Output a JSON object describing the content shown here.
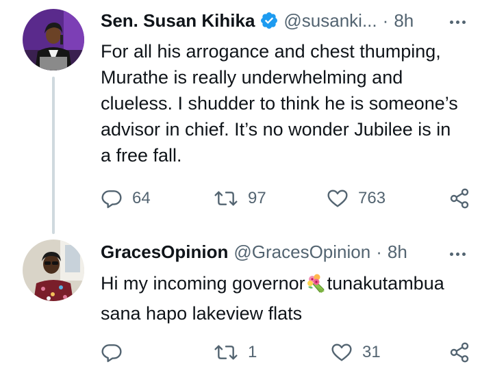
{
  "tweets": [
    {
      "name": "Sen. Susan Kihika",
      "verified": true,
      "handle": "@susanki...",
      "separator": "·",
      "time": "8h",
      "text_lines": [
        "For all his arrogance and chest thumping,",
        "Murathe is really underwhelming and",
        "clueless. I shudder to think he is someone’s",
        "advisor in chief. It’s no wonder Jubilee is in",
        "a free fall."
      ],
      "replies": "64",
      "retweets": "97",
      "likes": "763"
    },
    {
      "name": "GracesOpinion",
      "verified": false,
      "handle": "@GracesOpinion",
      "separator": "·",
      "time": "8h",
      "text_line1_before": "Hi my incoming governor",
      "text_line1_after": "tunakutambua",
      "text_line2": "sana hapo lakeview flats",
      "emoji": "bouquet",
      "replies": "",
      "retweets": "1",
      "likes": "31"
    }
  ],
  "icons": {
    "reply": "reply-icon",
    "retweet": "retweet-icon",
    "like": "heart-icon",
    "share": "share-icon",
    "more": "more-options-icon",
    "verified": "verified-badge-icon"
  },
  "colors": {
    "text": "#0f1419",
    "secondary": "#536471",
    "verified_blue": "#1d9bf0",
    "thread_line": "#cfd9de"
  }
}
